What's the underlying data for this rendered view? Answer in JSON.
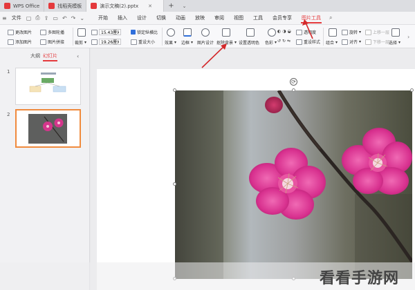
{
  "file_tabs": [
    {
      "label": "WPS Office",
      "color": "#e4393c"
    },
    {
      "label": "找稻壳模板",
      "color": "#e4393c"
    },
    {
      "label": "演示文稿(2).pptx",
      "color": "#e4393c"
    }
  ],
  "menu": {
    "file": "文件",
    "items": [
      "开始",
      "插入",
      "设计",
      "切换",
      "动画",
      "放映",
      "审阅",
      "视图",
      "工具",
      "会员专享"
    ],
    "active": "图片工具"
  },
  "ribbon": {
    "change_picture": "更改图片",
    "multi_crop": "多图轮播",
    "add_picture": "添加图片",
    "picture_combine": "图片拼接",
    "crop": "裁剪",
    "width_value": "15.43厘米",
    "height_value": "19.26厘米",
    "lock_ratio": "锁定纵横比",
    "reset_size": "重设大小",
    "effects": "效果",
    "border": "边框",
    "picture_design": "图片设计",
    "remove_background": "抠除背景",
    "set_transparent": "设置透明色",
    "color": "色彩",
    "transparency": "透明度",
    "reset_style": "重设样式",
    "group": "组合",
    "align": "对齐",
    "rotate": "旋转",
    "up_layer": "上移一层",
    "down_layer": "下移一层",
    "select": "选择"
  },
  "sidebar": {
    "tabs": [
      "大纲",
      "幻灯片"
    ],
    "active_tab": "幻灯片",
    "slides": [
      "1",
      "2"
    ],
    "selected": "2"
  },
  "watermark": "看看手游网",
  "colors": {
    "accent": "#e4393c",
    "selection": "#f08a3c",
    "arrow": "#d4282a"
  }
}
